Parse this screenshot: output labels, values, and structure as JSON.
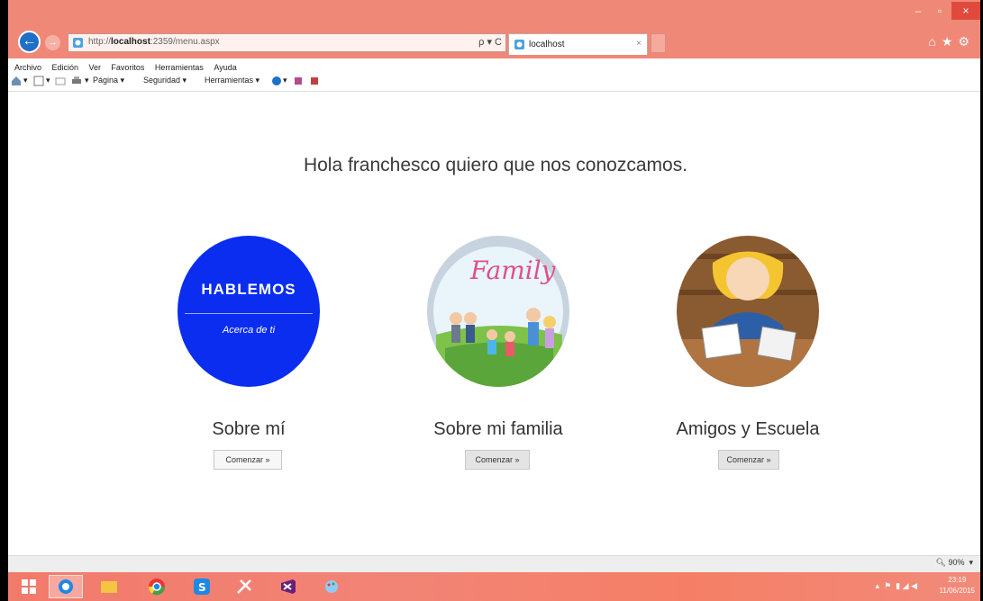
{
  "browser": {
    "window_controls": {
      "minimize": "–",
      "maximize": "▫",
      "close": "×"
    },
    "address": {
      "prefix": "http://",
      "host": "localhost",
      "rest": ":2359/menu.aspx",
      "tools": "ρ ▾ C"
    },
    "tab": {
      "title": "localhost",
      "close": "×"
    },
    "menu": [
      "Archivo",
      "Edición",
      "Ver",
      "Favoritos",
      "Herramientas",
      "Ayuda"
    ],
    "commands": {
      "page": "Página ▾",
      "security": "Seguridad ▾",
      "tools": "Herramientas ▾"
    }
  },
  "page": {
    "greeting": "Hola franchesco quiero que nos conozcamos.",
    "cards": [
      {
        "circle_title": "HABLEMOS",
        "circle_subtitle": "Acerca de ti",
        "label": "Sobre mí",
        "button": "Comenzar »"
      },
      {
        "circle_title": "Family",
        "label": "Sobre mi familia",
        "button": "Comenzar »"
      },
      {
        "label": "Amigos y Escuela",
        "button": "Comenzar »"
      }
    ]
  },
  "status": {
    "zoom": "90%"
  },
  "taskbar": {
    "time": "23:19",
    "date": "11/06/2015"
  },
  "colors": {
    "titlebar": "#f08878",
    "blue_circle": "#0a2df0"
  }
}
